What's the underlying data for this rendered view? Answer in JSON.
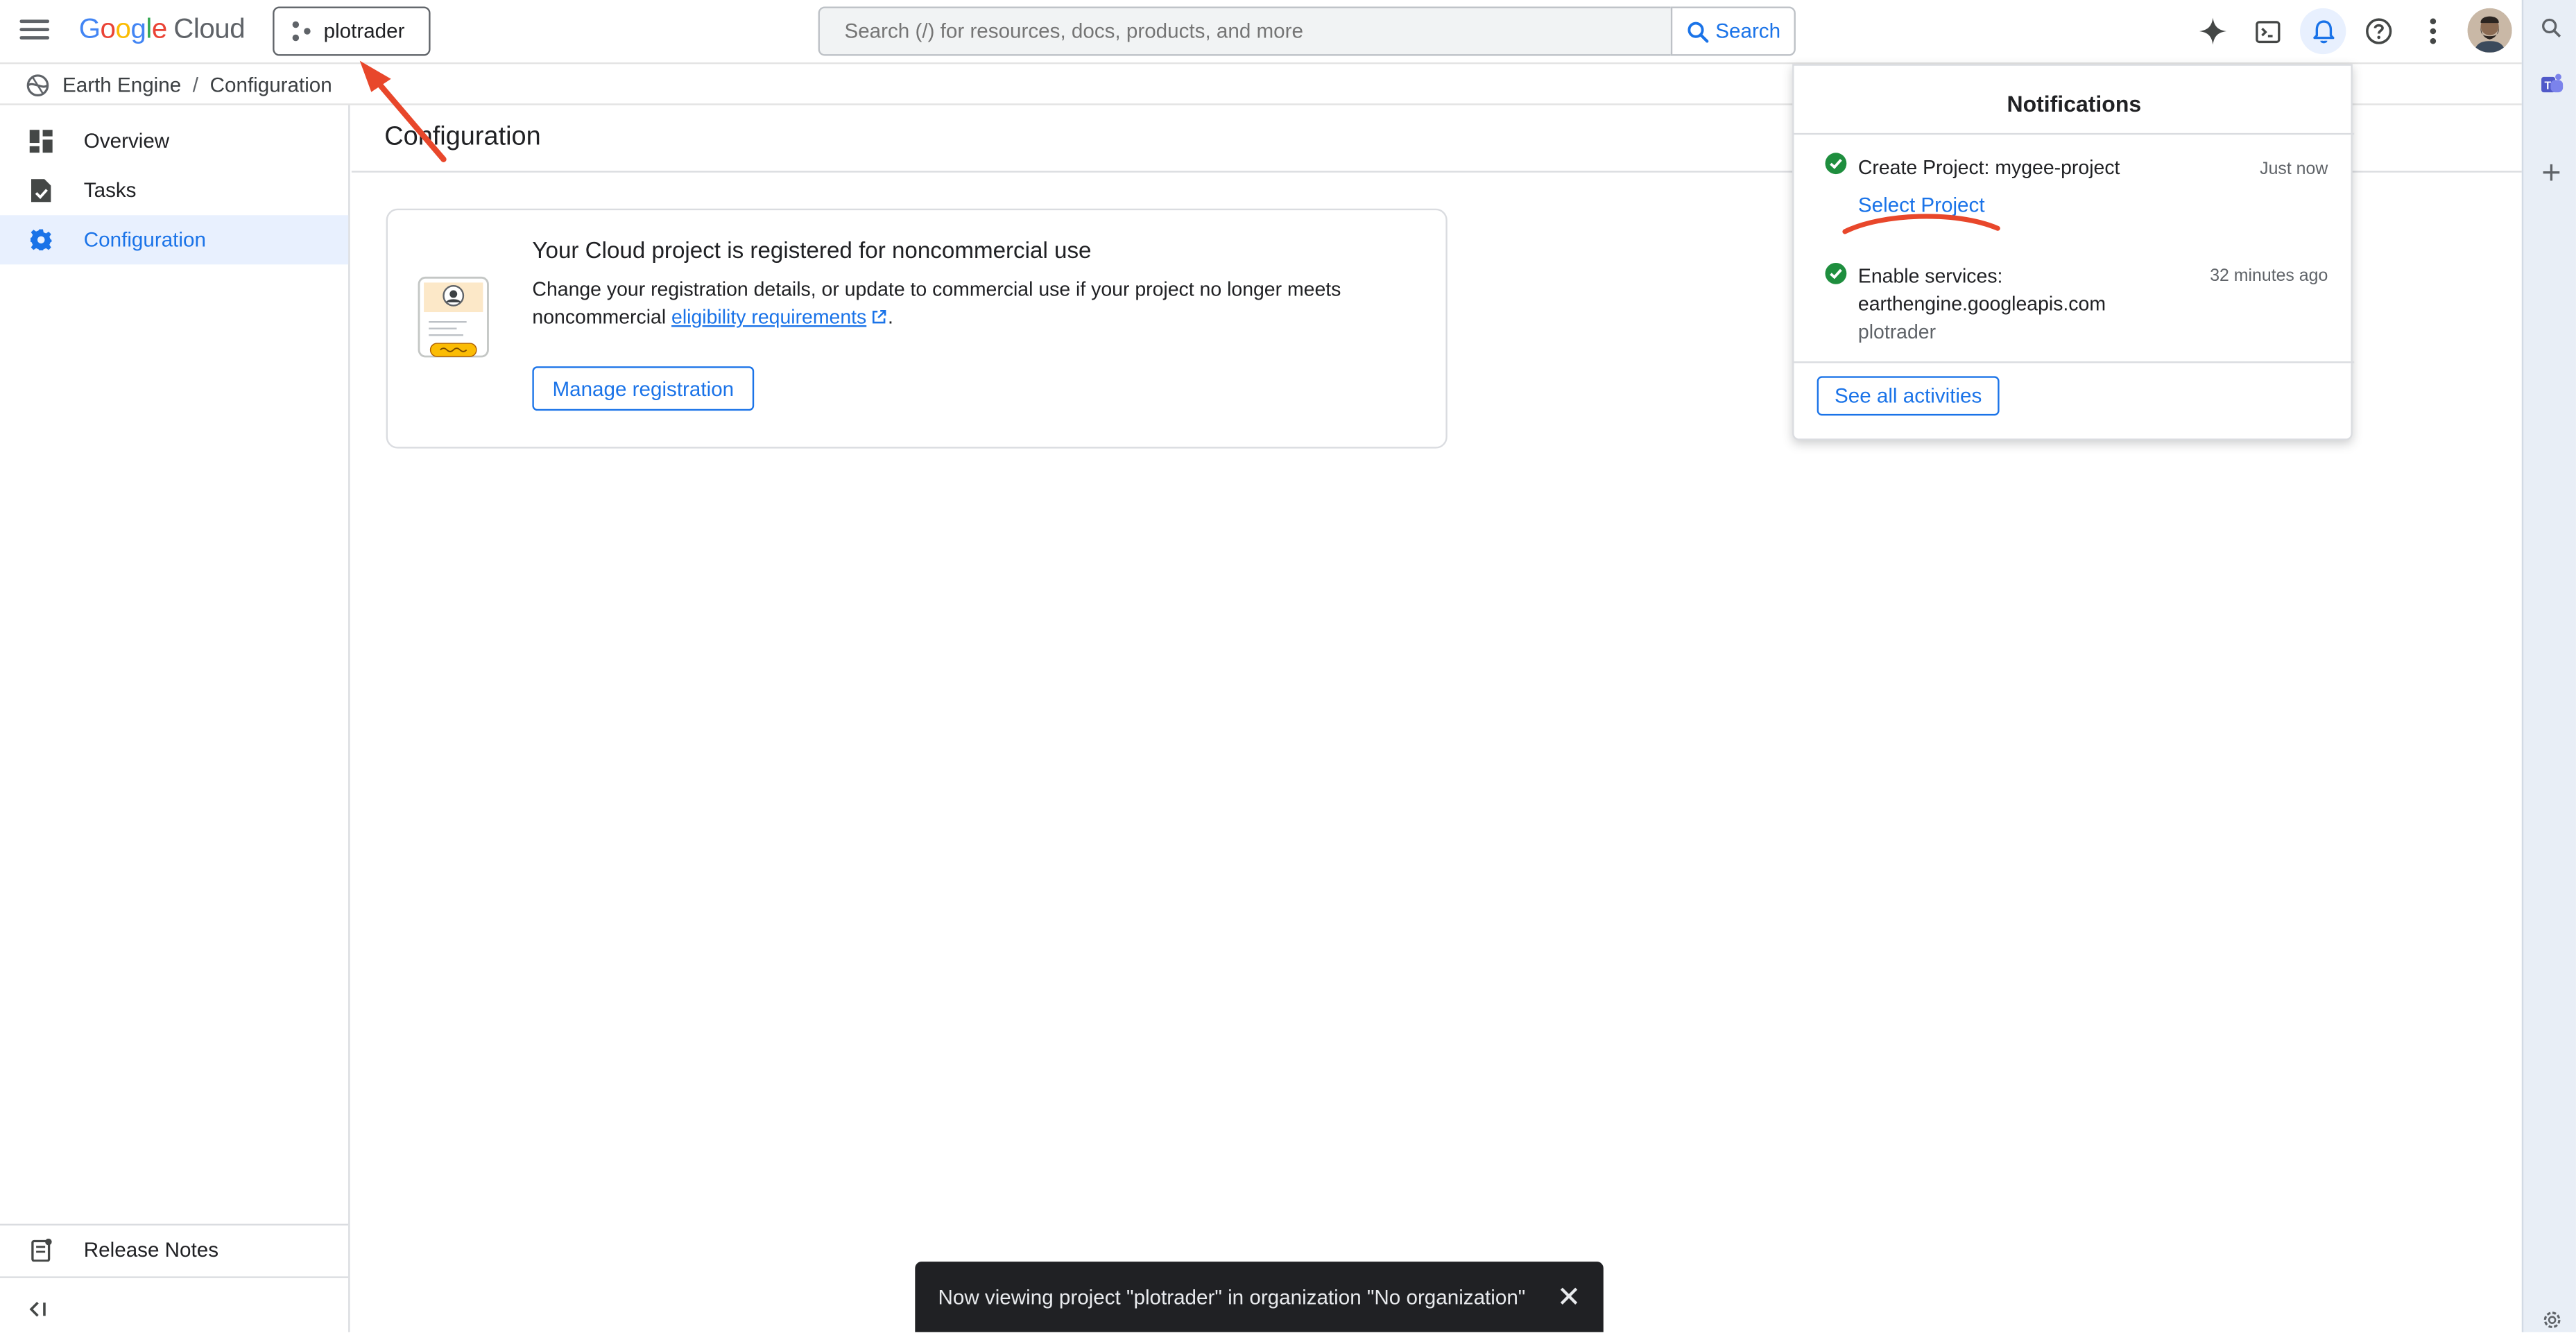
{
  "header": {
    "logo_word": [
      "G",
      "o",
      "o",
      "g",
      "l",
      "e"
    ],
    "logo_product": "Cloud",
    "project_name": "plotrader",
    "search_placeholder": "Search (/) for resources, docs, products, and more",
    "search_button": "Search"
  },
  "breadcrumb": {
    "items": [
      "Earth Engine",
      "Configuration"
    ],
    "separator": "/"
  },
  "sidebar": {
    "items": [
      {
        "label": "Overview",
        "icon": "dashboard-icon",
        "active": false
      },
      {
        "label": "Tasks",
        "icon": "tasks-icon",
        "active": false
      },
      {
        "label": "Configuration",
        "icon": "gear-icon",
        "active": true
      }
    ],
    "footer_item": {
      "label": "Release Notes",
      "icon": "release-notes-icon"
    },
    "collapse_icon": "collapse-sidebar-icon"
  },
  "main": {
    "page_title": "Configuration",
    "card": {
      "heading": "Your Cloud project is registered for noncommercial use",
      "body_prefix": "Change your registration details, or update to commercial use if your project no longer meets noncommercial ",
      "link_text": "eligibility requirements",
      "body_suffix": ".",
      "button": "Manage registration"
    }
  },
  "notifications": {
    "title": "Notifications",
    "items": [
      {
        "text": "Create Project: mygee-project",
        "time": "Just now",
        "action": "Select Project",
        "status": "success"
      },
      {
        "text": "Enable services:",
        "text2": "earthengine.googleapis.com",
        "sub": "plotrader",
        "time": "32 minutes ago",
        "status": "success"
      }
    ],
    "see_all": "See all activities"
  },
  "snackbar": {
    "message": "Now viewing project \"plotrader\" in organization \"No organization\""
  },
  "colors": {
    "accent": "#1a73e8",
    "success": "#1e8e3e",
    "annotation_red": "#e8472b",
    "active_nav_bg": "#e8f0fe"
  }
}
